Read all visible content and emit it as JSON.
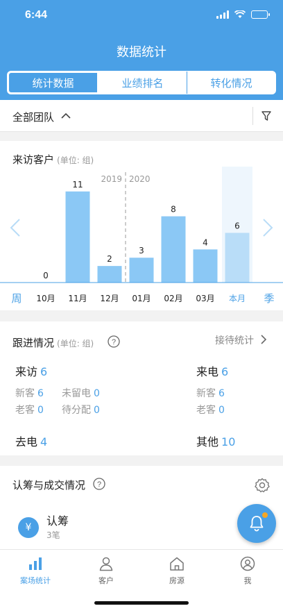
{
  "status_bar": {
    "time": "6:44"
  },
  "nav": {
    "title": "数据统计"
  },
  "segments": [
    {
      "label": "统计数据",
      "active": true
    },
    {
      "label": "业绩排名",
      "active": false
    },
    {
      "label": "转化情况",
      "active": false
    }
  ],
  "team_filter": {
    "label": "全部团队"
  },
  "visit": {
    "title": "来访客户",
    "unit": "(单位: 组)",
    "year_left": "2019",
    "year_right": "2020",
    "period_left": "周",
    "period_right": "季"
  },
  "chart_data": {
    "type": "bar",
    "title": "来访客户",
    "categories": [
      "10月",
      "11月",
      "12月",
      "01月",
      "02月",
      "03月",
      "本月"
    ],
    "values": [
      0,
      11,
      2,
      3,
      8,
      4,
      6
    ],
    "ylim": [
      0,
      14
    ],
    "grid": false,
    "highlight_category": "本月",
    "colors": {
      "bar": "#8bc8f5",
      "highlight_bar": "#b9ddf8",
      "highlight_bg": "#eef6fd"
    }
  },
  "follow": {
    "title": "跟进情况",
    "unit": "(单位: 组)",
    "link": "接待统计",
    "visit_label": "来访",
    "visit_value": "6",
    "visit_new_label": "新客",
    "visit_new_value": "6",
    "visit_nomsg_label": "未留电",
    "visit_nomsg_value": "0",
    "visit_old_label": "老客",
    "visit_old_value": "0",
    "visit_pending_label": "待分配",
    "visit_pending_value": "0",
    "call_in_label": "来电",
    "call_in_value": "6",
    "call_new_label": "新客",
    "call_new_value": "6",
    "call_old_label": "老客",
    "call_old_value": "0",
    "call_out_label": "去电",
    "call_out_value": "4",
    "other_label": "其他",
    "other_value": "10"
  },
  "deal": {
    "title": "认筹与成交情况",
    "sub_title": "认筹",
    "sub_count": "3笔",
    "yen": "¥"
  },
  "tabbar": [
    {
      "label": "案场统计",
      "icon": "bar-chart-icon",
      "active": true
    },
    {
      "label": "客户",
      "icon": "person-icon",
      "active": false
    },
    {
      "label": "房源",
      "icon": "house-icon",
      "active": false
    },
    {
      "label": "我",
      "icon": "profile-icon",
      "active": false
    }
  ],
  "colors": {
    "accent": "#4aa0e6",
    "badge": "#f5a623"
  }
}
